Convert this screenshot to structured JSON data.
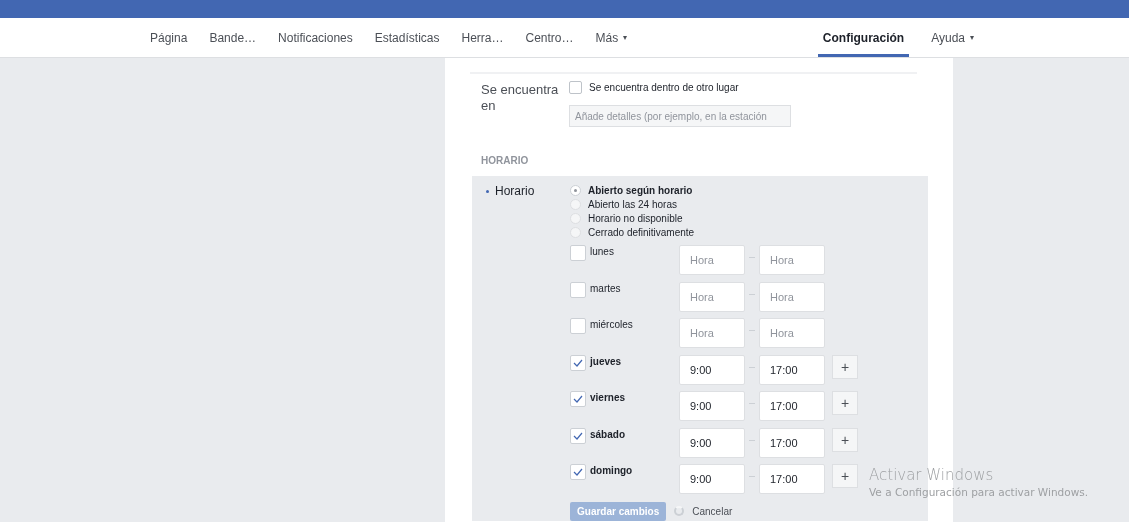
{
  "nav": {
    "items": [
      {
        "label": "Página",
        "selected": false,
        "dropdown": false
      },
      {
        "label": "Bande…",
        "selected": false,
        "dropdown": false
      },
      {
        "label": "Notificaciones",
        "selected": false,
        "dropdown": false
      },
      {
        "label": "Estadísticas",
        "selected": false,
        "dropdown": false
      },
      {
        "label": "Herra…",
        "selected": false,
        "dropdown": false
      },
      {
        "label": "Centro…",
        "selected": false,
        "dropdown": false
      },
      {
        "label": "Más",
        "selected": false,
        "dropdown": true
      }
    ],
    "right_items": [
      {
        "label": "Configuración",
        "selected": true,
        "dropdown": false
      },
      {
        "label": "Ayuda",
        "selected": false,
        "dropdown": true
      }
    ],
    "dropdown_glyph": "▾"
  },
  "location": {
    "label": "Se encuentra en",
    "checkbox": {
      "label": "Se encuentra dentro de otro lugar",
      "checked": false
    },
    "details": {
      "placeholder": "Añade detalles (por ejemplo, en la estación"
    }
  },
  "hours": {
    "section_title": "HORARIO",
    "label": "Horario",
    "options": [
      {
        "label": "Abierto según horario",
        "selected": true
      },
      {
        "label": "Abierto las 24 horas",
        "selected": false
      },
      {
        "label": "Horario no disponible",
        "selected": false
      },
      {
        "label": "Cerrado definitivamente",
        "selected": false
      }
    ],
    "days": [
      {
        "day": "lunes",
        "checked": false,
        "open_placeholder": "Hora",
        "close_placeholder": "Hora"
      },
      {
        "day": "martes",
        "checked": false,
        "open_placeholder": "Hora",
        "close_placeholder": "Hora"
      },
      {
        "day": "miércoles",
        "checked": false,
        "open_placeholder": "Hora",
        "close_placeholder": "Hora"
      },
      {
        "day": "jueves",
        "checked": true,
        "open": "9:00",
        "close": "17:00"
      },
      {
        "day": "viernes",
        "checked": true,
        "open": "9:00",
        "close": "17:00"
      },
      {
        "day": "sábado",
        "checked": true,
        "open": "9:00",
        "close": "17:00"
      },
      {
        "day": "domingo",
        "checked": true,
        "open": "9:00",
        "close": "17:00"
      }
    ],
    "add_glyph": "+",
    "save_button": {
      "label": "Guardar cambios",
      "disabled": true
    },
    "cancel": "Cancelar"
  },
  "os_notice": {
    "title": "Activar Windows",
    "subtitle": "Ve a Configuración para activar Windows."
  }
}
